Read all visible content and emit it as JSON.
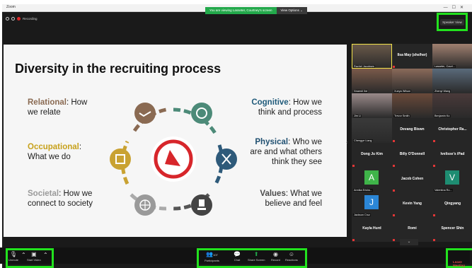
{
  "window": {
    "app_title": "Zoom",
    "controls": [
      "—",
      "☐",
      "✕"
    ]
  },
  "banner": {
    "text": "You are viewing Lasseter, Courtney's screen",
    "options_label": "View Options ⌄"
  },
  "recording": {
    "label": "Recording"
  },
  "speaker_view": {
    "label": "Speaker View"
  },
  "slide": {
    "title": "Diversity in the recruiting process",
    "relational": {
      "key": "Relational",
      "rest1": ": How",
      "rest2": "we relate"
    },
    "occupational": {
      "key": "Occupational",
      "rest1": ":",
      "rest2": "What we do"
    },
    "societal": {
      "key": "Societal",
      "rest1": ": How we",
      "rest2": "connect to society"
    },
    "cognitive": {
      "key": "Cognitive",
      "rest1": ": How we",
      "rest2": "think and process"
    },
    "physical": {
      "key": "Physical",
      "rest1": ": Who we",
      "rest2": "are and what others",
      "rest3": "think they see"
    },
    "values": {
      "key": "Values",
      "rest1": ": What we",
      "rest2": "believe and feel"
    }
  },
  "gallery": {
    "tiles": [
      {
        "name": "Rachel Jacobsen",
        "type": "video",
        "active": true
      },
      {
        "name": "Ilsa May (she/her)",
        "type": "name"
      },
      {
        "name": "Lasseter, Court...",
        "type": "video"
      },
      {
        "name": "Nnamdi Ibe",
        "type": "video"
      },
      {
        "name": "Xueya Wilson",
        "type": "video"
      },
      {
        "name": "Zhenyi Wang",
        "type": "video"
      },
      {
        "name": "Jim Li",
        "type": "video"
      },
      {
        "name": "Trevor Smith",
        "type": "video"
      },
      {
        "name": "Benjamin Ko",
        "type": "video"
      },
      {
        "name": "Chengye Liang",
        "type": "video"
      },
      {
        "name": "Devang Biswn",
        "type": "name"
      },
      {
        "name": "Christopher Ra...",
        "type": "name"
      },
      {
        "name": "Dong Ju Kim",
        "type": "name"
      },
      {
        "name": "Billy O'Donnell",
        "type": "name"
      },
      {
        "name": "Ivelisse's iPad",
        "type": "name"
      },
      {
        "name": "Annika Ericks...",
        "type": "avatar",
        "letter": "A",
        "color": "#3fb449"
      },
      {
        "name": "Jacob Cohen",
        "type": "name"
      },
      {
        "name": "Valentina Ro...",
        "type": "avatar",
        "letter": "V",
        "color": "#1e8d72"
      },
      {
        "name": "Jackson Cruz",
        "type": "avatar",
        "letter": "J",
        "color": "#2b86d6"
      },
      {
        "name": "Kevin Yang",
        "type": "name"
      },
      {
        "name": "Qingyang",
        "type": "name"
      },
      {
        "name": "Kayla Hurd",
        "type": "name"
      },
      {
        "name": "Romi",
        "type": "name"
      },
      {
        "name": "Spencer Shin",
        "type": "name"
      }
    ]
  },
  "toolbar": {
    "unmute": "Unmute",
    "start_video": "Start Video",
    "participants": "Participants",
    "participants_count": "107",
    "chat": "Chat",
    "share_screen": "Share Screen",
    "record": "Record",
    "reactions": "Reactions",
    "leave": "Leave Meeting"
  },
  "colors": {
    "highlight": "#22e21e",
    "brand_red": "#d7262b"
  }
}
